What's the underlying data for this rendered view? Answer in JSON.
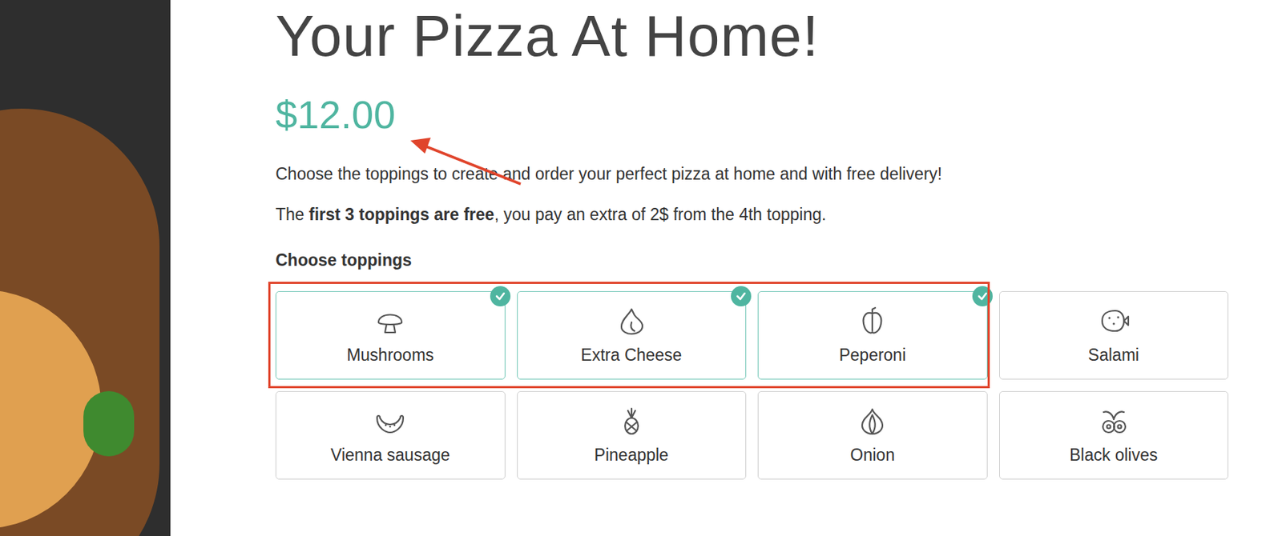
{
  "title": "Your Pizza At Home!",
  "price": "$12.00",
  "description": "Choose the toppings to create and order your perfect pizza at home and with free delivery!",
  "pricing_note": {
    "before": "The ",
    "bold": "first 3 toppings are free",
    "after": ", you pay an extra of 2$ from the 4th topping."
  },
  "toppings_heading": "Choose toppings",
  "toppings": [
    {
      "label": "Mushrooms",
      "selected": true
    },
    {
      "label": "Extra Cheese",
      "selected": true
    },
    {
      "label": "Peperoni",
      "selected": true
    },
    {
      "label": "Salami",
      "selected": false
    },
    {
      "label": "Vienna sausage",
      "selected": false
    },
    {
      "label": "Pineapple",
      "selected": false
    },
    {
      "label": "Onion",
      "selected": false
    },
    {
      "label": "Black olives",
      "selected": false
    }
  ]
}
